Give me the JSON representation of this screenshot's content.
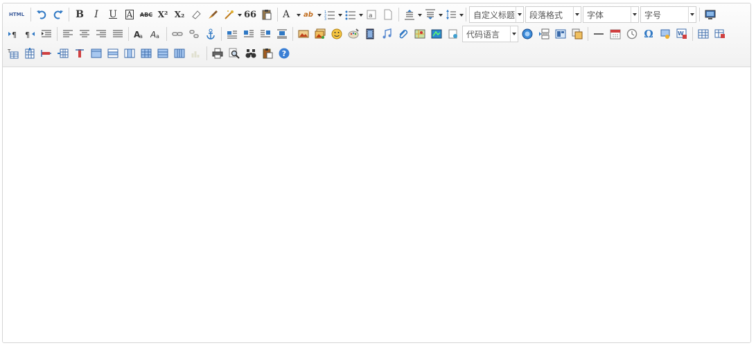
{
  "toolbar": {
    "html_label": "HTML",
    "bold": "B",
    "italic": "I",
    "underline": "U",
    "font_border": "A",
    "strike": "ABC",
    "superscript": "X²",
    "subscript": "X₂",
    "quote": "66",
    "forecolor": "A",
    "backcolor": "ab",
    "omega": "Ω",
    "help": "?",
    "combos": {
      "custom_title": "自定义标题",
      "paragraph_format": "段落格式",
      "font_family": "字体",
      "font_size": "字号",
      "code_language": "代码语言"
    }
  },
  "colors": {
    "accent_blue": "#2f78c4",
    "help_blue": "#3a7fd5",
    "border": "#d4d4d4"
  },
  "editor": {
    "content": ""
  }
}
